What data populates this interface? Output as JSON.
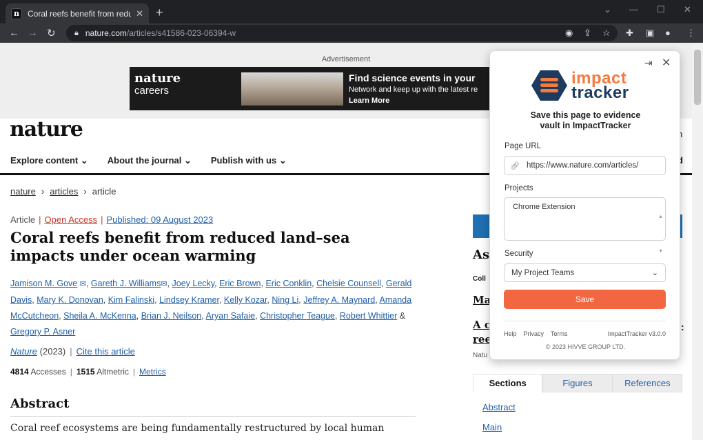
{
  "browser": {
    "tab_title": "Coral reefs benefit from reduced",
    "tab_favicon_letter": "n",
    "url_host": "nature.com",
    "url_path": "/articles/s41586-023-06394-w"
  },
  "ad": {
    "label": "Advertisement",
    "brand_line1": "nature",
    "brand_line2": "careers",
    "headline": "Find science events in your",
    "subline": "Network and keep up with the latest re",
    "cta": "Learn More"
  },
  "site": {
    "logo": "nature",
    "nav": [
      "Explore content",
      "About the journal",
      "Publish with us"
    ]
  },
  "breadcrumb": {
    "home": "nature",
    "section": "articles",
    "current": "article"
  },
  "article": {
    "type": "Article",
    "access": "Open Access",
    "published": "Published: 09 August 2023",
    "title": "Coral reefs benefit from reduced land–sea impacts under ocean warming",
    "authors": [
      "Jamison M. Gove",
      "Gareth J. Williams",
      "Joey Lecky",
      "Eric Brown",
      "Eric Conklin",
      "Chelsie Counsell",
      "Gerald Davis",
      "Mary K. Donovan",
      "Kim Falinski",
      "Lindsey Kramer",
      "Kelly Kozar",
      "Ning Li",
      "Jeffrey A. Maynard",
      "Amanda McCutcheon",
      "Sheila A. McKenna",
      "Brian J. Neilson",
      "Aryan Safaie",
      "Christopher Teague",
      "Robert Whittier",
      "Gregory P. Asner"
    ],
    "and": "&",
    "journal": "Nature",
    "year": "(2023)",
    "cite_label": "Cite this article",
    "accesses_value": "4814",
    "accesses_label": "Accesses",
    "altmetric_value": "1515",
    "altmetric_label": "Altmetric",
    "metrics_label": "Metrics",
    "abstract_heading": "Abstract",
    "abstract_start": "Coral reef ecosystems are being fundamentally restructured by local human"
  },
  "sidebar": {
    "heading_fragment": "As",
    "coll_fragment": "Coll",
    "ma_fragment": "Ma",
    "ac_fragment": "A c",
    "ree_fragment": "ree",
    "natu_fragment": "Natu",
    "n_fragment": "n",
    "d_fragment": "d",
    "dot_fragment": ":",
    "tabs": [
      "Sections",
      "Figures",
      "References"
    ],
    "links": [
      "Abstract",
      "Main"
    ]
  },
  "popup": {
    "brand_top": "impact",
    "brand_bottom": "tracker",
    "heading": "Save this page to evidence vault in ImpactTracker",
    "url_label": "Page URL",
    "url_value": "https://www.nature.com/articles/",
    "projects_label": "Projects",
    "project_value": "Chrome Extension",
    "security_label": "Security",
    "security_value": "My Project Teams",
    "save_label": "Save",
    "footer_links": [
      "Help",
      "Privacy",
      "Terms"
    ],
    "version": "ImpactTracker v3.0.0",
    "copyright": "© 2023 HIVVE GROUP LTD."
  },
  "colors": {
    "brand_orange": "#f47b3d",
    "brand_navy": "#1e3a5f",
    "save_button": "#f26641",
    "link_blue": "#1f5fa8"
  }
}
